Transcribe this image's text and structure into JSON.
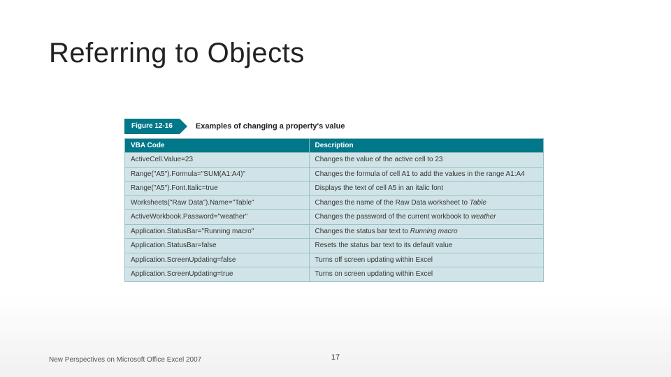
{
  "title": "Referring to Objects",
  "figure": {
    "label": "Figure 12-16",
    "caption": "Examples of changing a property's value",
    "columns": [
      "VBA Code",
      "Description"
    ],
    "rows": [
      {
        "code": "ActiveCell.Value=23",
        "desc": "Changes the value of the active cell to 23"
      },
      {
        "code": "Range(\"A5\").Formula=\"SUM(A1:A4)\"",
        "desc": "Changes the formula of cell A1 to add the values in the range A1:A4"
      },
      {
        "code": "Range(\"A5\").Font.Italic=true",
        "desc": "Displays the text of cell A5 in an italic font"
      },
      {
        "code": "Worksheets(\"Raw Data\").Name=\"Table\"",
        "desc": "Changes the name of the Raw Data worksheet to <em>Table</em>"
      },
      {
        "code": "ActiveWorkbook.Password=\"weather\"",
        "desc": "Changes the password of the current workbook to <em>weather</em>"
      },
      {
        "code": "Application.StatusBar=\"Running macro\"",
        "desc": "Changes the status bar text to <em>Running macro</em>"
      },
      {
        "code": "Application.StatusBar=false",
        "desc": "Resets the status bar text to its default value"
      },
      {
        "code": "Application.ScreenUpdating=false",
        "desc": "Turns off screen updating within Excel"
      },
      {
        "code": "Application.ScreenUpdating=true",
        "desc": "Turns on screen updating within Excel"
      }
    ]
  },
  "footer": {
    "source": "New Perspectives on Microsoft Office Excel 2007",
    "page": "17"
  }
}
